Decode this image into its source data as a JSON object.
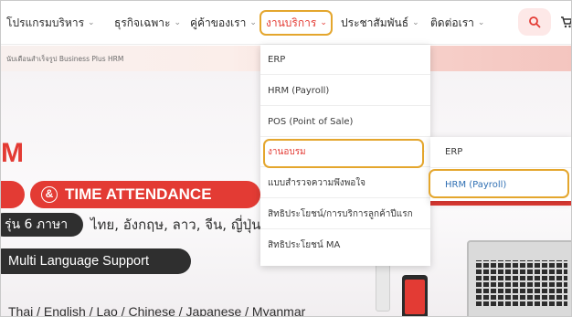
{
  "nav": {
    "items": [
      {
        "label": "โปรแกรมบริหาร",
        "active": false
      },
      {
        "label": "ธุรกิจเฉพาะ",
        "active": false
      },
      {
        "label": "คู่ค้าของเรา",
        "active": false
      },
      {
        "label": "งานบริการ",
        "active": true
      },
      {
        "label": "ประชาสัมพันธ์",
        "active": false
      },
      {
        "label": "ติดต่อเรา",
        "active": false
      }
    ],
    "search_icon": "search-icon",
    "cart_icon": "cart-icon"
  },
  "breadcrumb": "นับเดือนสำเร็จรูป Business Plus HRM",
  "dropdown": {
    "items": [
      {
        "label": "ERP"
      },
      {
        "label": "HRM (Payroll)"
      },
      {
        "label": "POS (Point of Sale)"
      },
      {
        "label": "งานอบรม",
        "active": true,
        "has_submenu": true
      },
      {
        "label": "แบบสำรวจความพึงพอใจ"
      },
      {
        "label": "สิทธิประโยชน์/การบริการลูกค้าปีแรก"
      },
      {
        "label": "สิทธิประโยชน์ MA"
      }
    ],
    "submenu_arrow": "›"
  },
  "submenu": {
    "items": [
      {
        "label": "ERP"
      },
      {
        "label": "HRM (Payroll)",
        "active": true
      }
    ]
  },
  "hero": {
    "big_letter": "M",
    "time_attendance": "TIME ATTENDANCE",
    "amp_symbol": "&",
    "lang_pill": "รุ่น 6 ภาษา",
    "lang_list": "ไทย, อังกฤษ, ลาว, จีน, ญี่ปุ่น",
    "multi_language": "Multi Language Support",
    "langs_line": "Thai / English / Lao / Chinese / Japanese / Myanmar"
  },
  "colors": {
    "brand_red": "#e33b34",
    "highlight_border": "#e4a62d",
    "link_blue": "#2f6fb3"
  }
}
